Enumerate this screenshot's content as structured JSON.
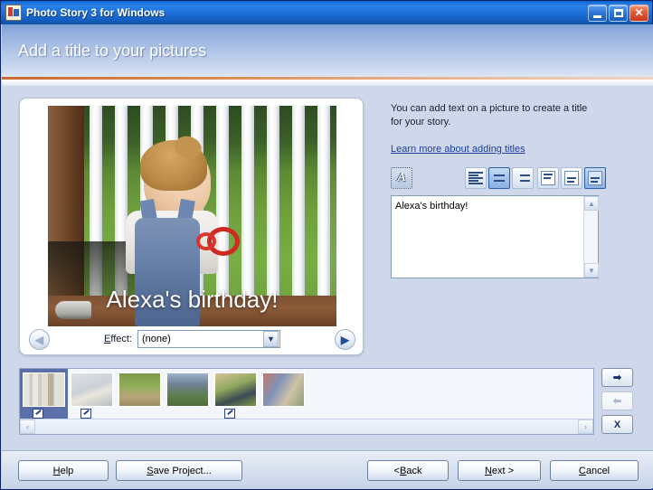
{
  "window": {
    "title": "Photo Story 3 for Windows",
    "app_icon": "photo-story-icon",
    "minimize_label": "",
    "maximize_label": "",
    "close_label": "✕"
  },
  "header": {
    "title": "Add a title to your pictures"
  },
  "picture_panel": {
    "photo_overlay_text": "Alexa's birthday!",
    "prev_arrow": "◀",
    "next_arrow": "▶",
    "effect_label_pre": "",
    "effect_label_accel": "E",
    "effect_label_post": "ffect:",
    "effect_value": "(none)",
    "effect_dropdown_arrow": "▼"
  },
  "right_panel": {
    "intro_text": "You can add text on a picture to create a title for your story.",
    "help_link": "Learn more about adding titles",
    "toolbar": {
      "font_button": "A",
      "align_left": "align-left",
      "align_center": "align-center",
      "align_right": "align-right",
      "valign_top": "valign-top",
      "valign_middle": "valign-middle",
      "valign_bottom": "valign-bottom",
      "selected_align": "align-center",
      "selected_valign": "valign-bottom"
    },
    "text_box": {
      "value": "Alexa's birthday!",
      "scroll_up": "▲",
      "scroll_down": "▼"
    }
  },
  "filmstrip": {
    "selected_index": 0,
    "thumbnails": [
      {
        "name": "thumb-1-baby-fence",
        "has_edit_badge": true
      },
      {
        "name": "thumb-2-baby-indoor",
        "has_edit_badge": true
      },
      {
        "name": "thumb-3-man-grass",
        "has_edit_badge": false
      },
      {
        "name": "thumb-4-family-outdoors",
        "has_edit_badge": false
      },
      {
        "name": "thumb-5-child-swing",
        "has_edit_badge": true
      },
      {
        "name": "thumb-6-kids-blanket",
        "has_edit_badge": false
      }
    ],
    "scroll_left": "‹",
    "scroll_right": "›"
  },
  "side_buttons": {
    "move_right": "➡",
    "move_left": "⬅",
    "remove": "X"
  },
  "footer": {
    "help": {
      "pre": "",
      "accel": "H",
      "post": "elp"
    },
    "save_project": {
      "pre": "",
      "accel": "S",
      "post": "ave Project..."
    },
    "back": {
      "pre": "< ",
      "accel": "B",
      "post": "ack"
    },
    "next": {
      "pre": "",
      "accel": "N",
      "post": "ext >"
    },
    "cancel": {
      "pre": "",
      "accel": "C",
      "post": "ancel"
    }
  },
  "colors": {
    "titlebar_blue": "#1e74dd",
    "header_blue": "#95b0de",
    "accent_orange": "#c86a34",
    "body_background": "#cfd8ea",
    "selection_blue": "#5b6fa8",
    "link_blue": "#1a3fa0"
  }
}
